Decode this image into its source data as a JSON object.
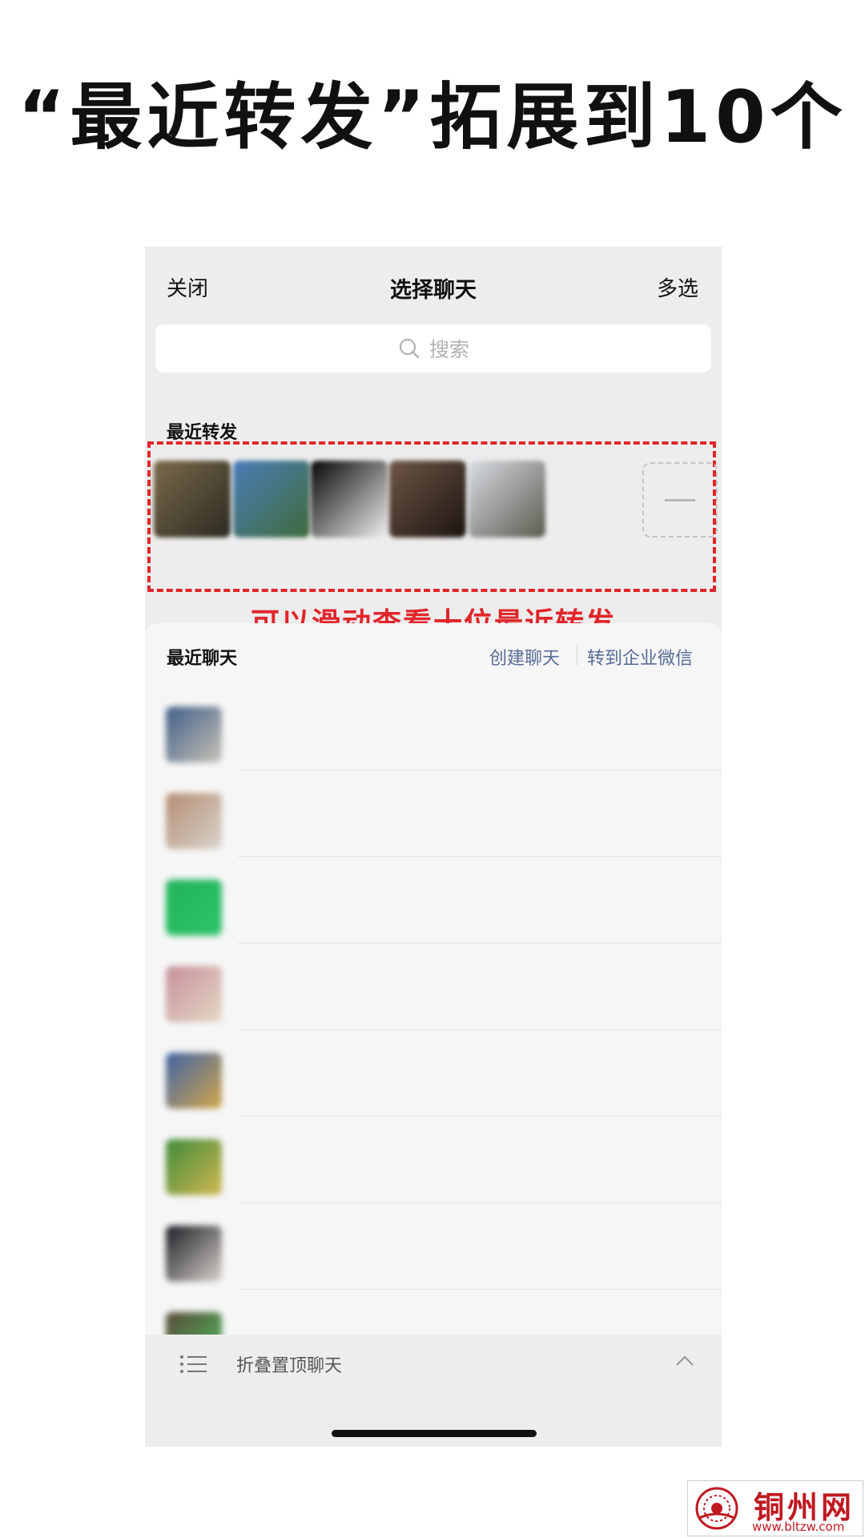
{
  "headline": "“最近转发”拓展到10个",
  "nav": {
    "close": "关闭",
    "title": "选择聊天",
    "multi_select": "多选"
  },
  "search": {
    "placeholder": "搜索"
  },
  "recent_forward": {
    "label": "最近转发",
    "items": [
      {
        "name": "",
        "colors": [
          "#7a6a4a",
          "#2c2a22"
        ]
      },
      {
        "name": "",
        "colors": [
          "#4a7db8",
          "#3f6b3a"
        ]
      },
      {
        "name": "",
        "colors": [
          "#050505",
          "#f0f0f0"
        ]
      },
      {
        "name": "",
        "colors": [
          "#6e5646",
          "#1c1410"
        ]
      },
      {
        "name": "",
        "colors": [
          "#d9dde3",
          "#5b5b50"
        ]
      }
    ],
    "more_icon": "minus-icon",
    "annotation": "可以滑动查看十位最近转发"
  },
  "recent_chats": {
    "title": "最近聊天",
    "create_chat": "创建聊天",
    "to_work_wechat": "转到企业微信",
    "rows": [
      {
        "name": "",
        "colors": [
          "#3e5e86",
          "#c8c2b8"
        ]
      },
      {
        "name": "",
        "colors": [
          "#b48c72",
          "#d9d4cc"
        ]
      },
      {
        "name": "",
        "colors": [
          "#20b35a",
          "#2fc36a"
        ]
      },
      {
        "name": "",
        "colors": [
          "#c6909c",
          "#e4d7c4"
        ]
      },
      {
        "name": "",
        "colors": [
          "#3d63a6",
          "#d4a64a"
        ]
      },
      {
        "name": "",
        "colors": [
          "#3d8a3a",
          "#d1b84f"
        ]
      },
      {
        "name": "",
        "colors": [
          "#1c1c22",
          "#d7d2cc"
        ]
      },
      {
        "name": "",
        "colors": [
          "#5a4a3c",
          "#4cbf5a"
        ]
      }
    ]
  },
  "footer": {
    "label": "折叠置顶聊天",
    "list_icon": "list-icon",
    "chevron": "chevron-up-icon"
  },
  "watermark": {
    "title": "铜州网",
    "url": "www.bltzw.com"
  }
}
